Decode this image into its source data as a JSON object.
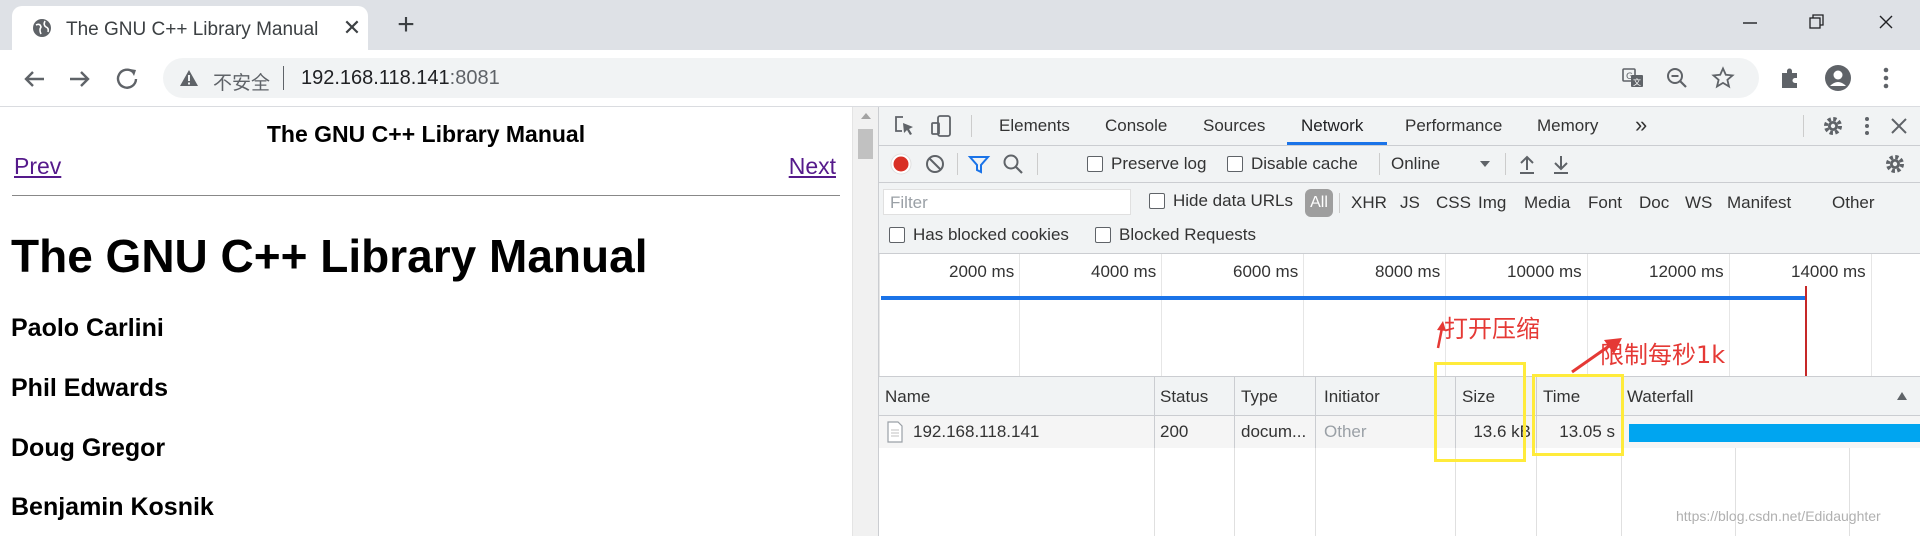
{
  "browser": {
    "tab_title": "The GNU C++ Library Manual",
    "security_label": "不安全",
    "url_host": "192.168.118.141",
    "url_port": ":8081"
  },
  "page": {
    "header_title": "The GNU C++ Library Manual",
    "prev_link": "Prev",
    "next_link": "Next",
    "main_title": "The GNU C++ Library Manual",
    "authors": [
      "Paolo Carlini",
      "Phil Edwards",
      "Doug Gregor",
      "Benjamin Kosnik"
    ]
  },
  "devtools": {
    "tabs": [
      "Elements",
      "Console",
      "Sources",
      "Network",
      "Performance",
      "Memory"
    ],
    "active_tab": "Network",
    "network_toolbar": {
      "preserve_log": "Preserve log",
      "disable_cache": "Disable cache",
      "throttling": "Online"
    },
    "filter": {
      "placeholder": "Filter",
      "hide_data_urls": "Hide data URLs",
      "types": [
        "All",
        "XHR",
        "JS",
        "CSS",
        "Img",
        "Media",
        "Font",
        "Doc",
        "WS",
        "Manifest",
        "Other"
      ],
      "has_blocked_cookies": "Has blocked cookies",
      "blocked_requests": "Blocked Requests"
    },
    "overview_ticks": [
      "2000 ms",
      "4000 ms",
      "6000 ms",
      "8000 ms",
      "10000 ms",
      "12000 ms",
      "14000 ms"
    ],
    "columns": [
      "Name",
      "Status",
      "Type",
      "Initiator",
      "Size",
      "Time",
      "Waterfall"
    ],
    "requests": [
      {
        "name": "192.168.118.141",
        "status": "200",
        "type": "docum...",
        "initiator": "Other",
        "size": "13.6 kB",
        "time": "13.05 s"
      }
    ]
  },
  "annotations": {
    "compression_note": "打开压缩",
    "throttle_note": "限制每秒1k",
    "color": "#e53935",
    "box_color": "#ffeb3b"
  },
  "watermark": "https://blog.csdn.net/Edidaughter"
}
